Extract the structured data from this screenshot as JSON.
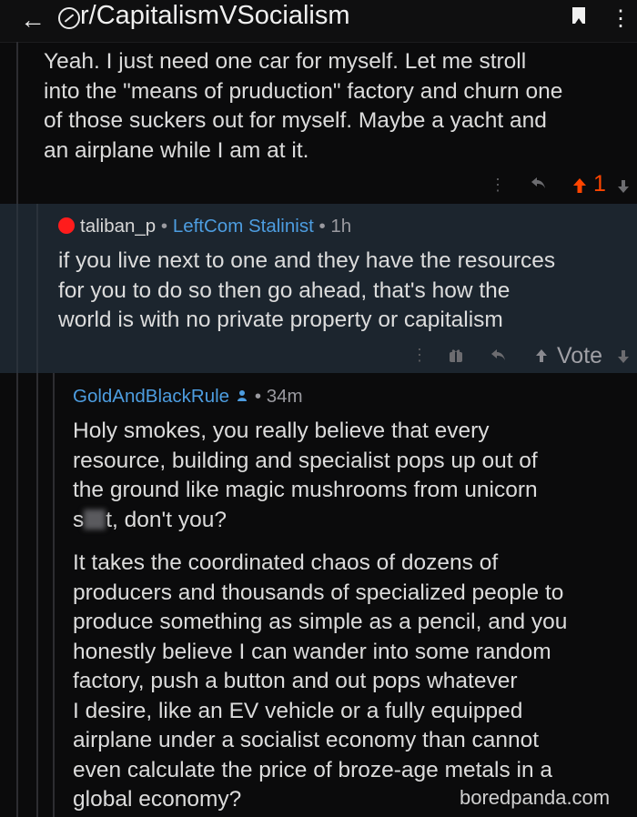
{
  "header": {
    "back_icon": "←",
    "title": "r/CapitalismVSocialism",
    "kebab_icon": "⋮"
  },
  "comments": [
    {
      "lines": [
        "Yeah. I just need one car for myself. Let me stroll",
        "into the \"means of pruduction\" factory and churn one",
        "of those suckers out for myself. Maybe a yacht and",
        "an airplane while I am at it."
      ],
      "score": "1"
    },
    {
      "author": "taliban_p",
      "separator": "•",
      "flair": "LeftCom Stalinist",
      "time": "1h",
      "lines": [
        "if you live next to one and they have the resources",
        "for you to do so then go ahead, that's how the",
        "world is with no private property or capitalism"
      ],
      "vote_label": "Vote"
    },
    {
      "author": "GoldAndBlackRule",
      "time": "34m",
      "para1": [
        "Holy smokes, you really believe that every",
        "resource, building and specialist pops up out of",
        "the ground like magic mushrooms from unicorn"
      ],
      "censored_prefix": "s",
      "censored_suffix": "t, don't you?",
      "para2": [
        "It takes the coordinated chaos of dozens of",
        "producers and thousands of specialized people to",
        "produce something as simple as a pencil, and you",
        "honestly believe I can wander into some random",
        "factory, push a button and out pops whatever",
        "I desire, like an EV vehicle or a fully equipped",
        "airplane under a socialist economy than cannot",
        "even calculate the price of broze-age metals in a",
        "global economy?"
      ]
    }
  ],
  "watermark": "boredpanda.com",
  "colors": {
    "background": "#0b0b0c",
    "highlight_bg": "#1c252e",
    "flair": "#4d9de0",
    "upvote": "#ff4500",
    "author2": "#4d9de0"
  },
  "icons": [
    "back-arrow-icon",
    "subreddit-icon",
    "bookmark-icon",
    "more-icon",
    "reply-icon",
    "upvote-icon",
    "downvote-icon",
    "award-icon",
    "mod-icon"
  ]
}
